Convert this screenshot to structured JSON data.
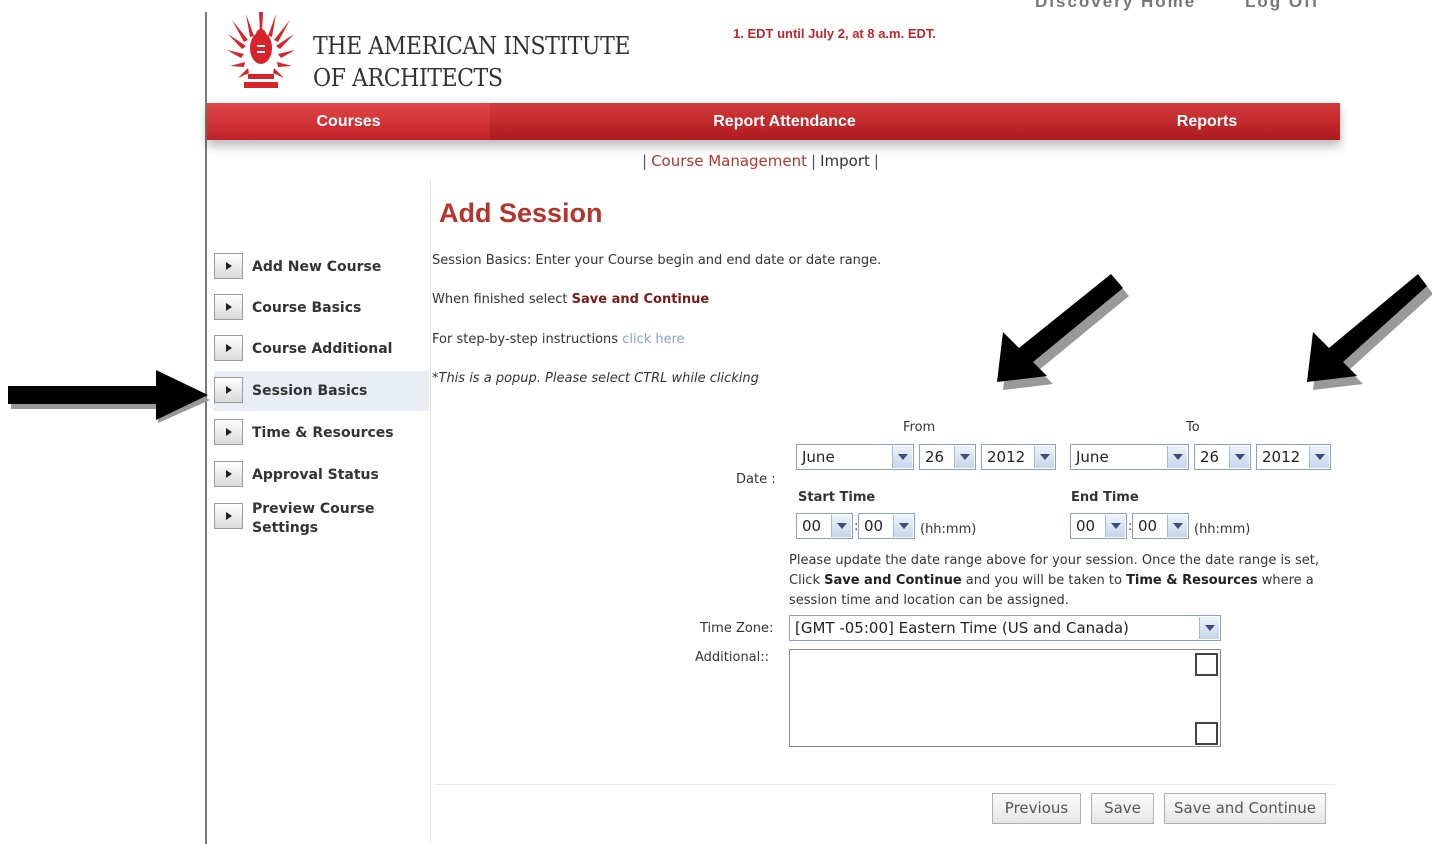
{
  "header": {
    "org_name_line1": "THE AMERICAN INSTITUTE",
    "org_name_line2": "OF ARCHITECTS",
    "notice": "1. EDT until July 2, at 8 a.m. EDT.",
    "cut_link_1": "Discovery Home",
    "cut_link_2": "Log Off"
  },
  "nav": {
    "items": [
      {
        "label": "Courses"
      },
      {
        "label": "Report Attendance"
      },
      {
        "label": "Reports"
      }
    ],
    "brand_color": "#c0272d"
  },
  "subnav": {
    "items": [
      {
        "label": "Course Management"
      },
      {
        "label": "Import"
      }
    ]
  },
  "sidebar": {
    "items": [
      {
        "label": "Add New Course"
      },
      {
        "label": "Course Basics"
      },
      {
        "label": "Course Additional"
      },
      {
        "label": "Session Basics"
      },
      {
        "label": "Time & Resources"
      },
      {
        "label": "Approval Status"
      },
      {
        "label": "Preview Course Settings"
      }
    ],
    "active": "Session Basics"
  },
  "main": {
    "title": "Add Session",
    "intro": "Session Basics: Enter your Course begin and end date or date range.",
    "finished_prefix": "When finished select ",
    "finished_action": "Save and Continue",
    "instructions_prefix": "For step-by-step instructions ",
    "instructions_link": "click here",
    "popup_note": "*This is a popup. Please select CTRL while clicking"
  },
  "form": {
    "from_label": "From",
    "to_label": "To",
    "date_label": "Date :",
    "from_month": "June",
    "from_day": "26",
    "from_year": "2012",
    "to_month": "June",
    "to_day": "26",
    "to_year": "2012",
    "start_time_label": "Start Time",
    "end_time_label": "End Time",
    "start_hh": "00",
    "start_mm": "00",
    "end_hh": "00",
    "end_mm": "00",
    "time_colon": ":",
    "time_format": "(hh:mm)",
    "note_1": "Please update the date range above for your session. Once the date range is set, Click ",
    "note_bold_1": "Save and Continue",
    "note_2": " and you will be taken to ",
    "note_bold_2": "Time & Resources",
    "note_3": " where a session time and location can be assigned.",
    "timezone_label": "Time Zone:",
    "timezone_value": "[GMT -05:00] Eastern Time (US and Canada)",
    "additional_label": "Additional::",
    "additional_value": ""
  },
  "buttons": {
    "previous": "Previous",
    "save": "Save",
    "save_continue": "Save and Continue"
  }
}
